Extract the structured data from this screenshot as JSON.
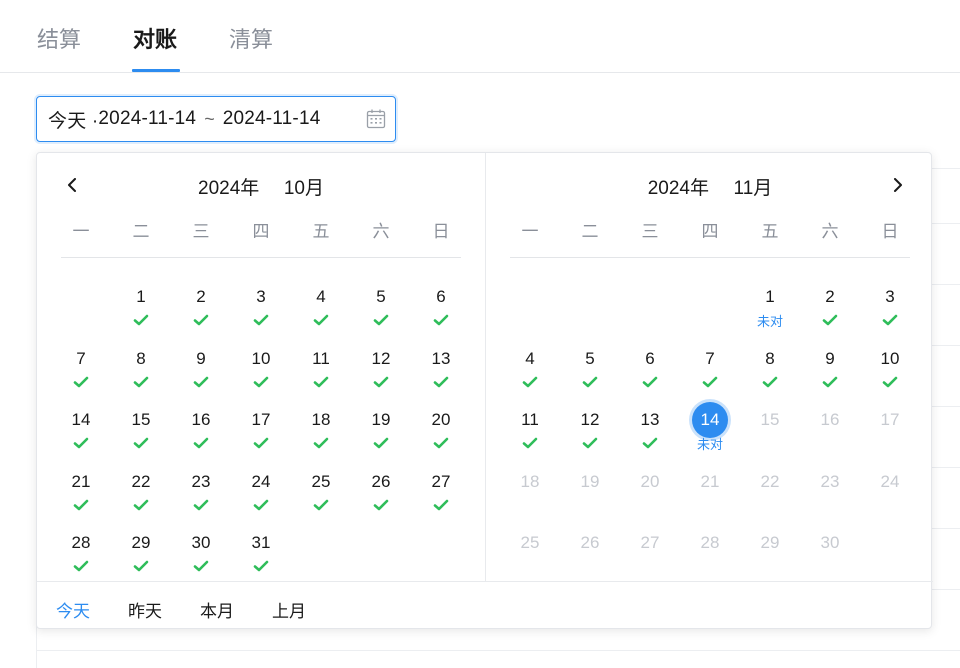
{
  "tabs": [
    {
      "label": "结算"
    },
    {
      "label": "对账"
    },
    {
      "label": "清算"
    }
  ],
  "active_tab": "对账",
  "date_range": {
    "preset": "今天 · ",
    "start": "2024-11-14",
    "separator": "~",
    "end": "2024-11-14"
  },
  "colors": {
    "accent": "#2d8cf0",
    "check": "#2fbd5a",
    "disabled_text": "#c7cad0",
    "muted_text": "#8a8f99"
  },
  "weekdays": [
    "一",
    "二",
    "三",
    "四",
    "五",
    "六",
    "日"
  ],
  "left_calendar": {
    "year": "2024年",
    "month": "10月",
    "first_weekday_index": 1,
    "days": [
      {
        "d": "1",
        "status": "check"
      },
      {
        "d": "2",
        "status": "check"
      },
      {
        "d": "3",
        "status": "check"
      },
      {
        "d": "4",
        "status": "check"
      },
      {
        "d": "5",
        "status": "check"
      },
      {
        "d": "6",
        "status": "check"
      },
      {
        "d": "7",
        "status": "check"
      },
      {
        "d": "8",
        "status": "check"
      },
      {
        "d": "9",
        "status": "check"
      },
      {
        "d": "10",
        "status": "check"
      },
      {
        "d": "11",
        "status": "check"
      },
      {
        "d": "12",
        "status": "check"
      },
      {
        "d": "13",
        "status": "check"
      },
      {
        "d": "14",
        "status": "check"
      },
      {
        "d": "15",
        "status": "check"
      },
      {
        "d": "16",
        "status": "check"
      },
      {
        "d": "17",
        "status": "check"
      },
      {
        "d": "18",
        "status": "check"
      },
      {
        "d": "19",
        "status": "check"
      },
      {
        "d": "20",
        "status": "check"
      },
      {
        "d": "21",
        "status": "check"
      },
      {
        "d": "22",
        "status": "check"
      },
      {
        "d": "23",
        "status": "check"
      },
      {
        "d": "24",
        "status": "check"
      },
      {
        "d": "25",
        "status": "check"
      },
      {
        "d": "26",
        "status": "check"
      },
      {
        "d": "27",
        "status": "check"
      },
      {
        "d": "28",
        "status": "check"
      },
      {
        "d": "29",
        "status": "check"
      },
      {
        "d": "30",
        "status": "check"
      },
      {
        "d": "31",
        "status": "check"
      }
    ]
  },
  "right_calendar": {
    "year": "2024年",
    "month": "11月",
    "first_weekday_index": 4,
    "days": [
      {
        "d": "1",
        "status": "tag",
        "tag": "未对"
      },
      {
        "d": "2",
        "status": "check"
      },
      {
        "d": "3",
        "status": "check"
      },
      {
        "d": "4",
        "status": "check"
      },
      {
        "d": "5",
        "status": "check"
      },
      {
        "d": "6",
        "status": "check"
      },
      {
        "d": "7",
        "status": "check"
      },
      {
        "d": "8",
        "status": "check"
      },
      {
        "d": "9",
        "status": "check"
      },
      {
        "d": "10",
        "status": "check"
      },
      {
        "d": "11",
        "status": "check"
      },
      {
        "d": "12",
        "status": "check"
      },
      {
        "d": "13",
        "status": "check"
      },
      {
        "d": "14",
        "status": "tag",
        "tag": "未对",
        "selected": true
      },
      {
        "d": "15",
        "disabled": true
      },
      {
        "d": "16",
        "disabled": true
      },
      {
        "d": "17",
        "disabled": true
      },
      {
        "d": "18",
        "disabled": true
      },
      {
        "d": "19",
        "disabled": true
      },
      {
        "d": "20",
        "disabled": true
      },
      {
        "d": "21",
        "disabled": true
      },
      {
        "d": "22",
        "disabled": true
      },
      {
        "d": "23",
        "disabled": true
      },
      {
        "d": "24",
        "disabled": true
      },
      {
        "d": "25",
        "disabled": true
      },
      {
        "d": "26",
        "disabled": true
      },
      {
        "d": "27",
        "disabled": true
      },
      {
        "d": "28",
        "disabled": true
      },
      {
        "d": "29",
        "disabled": true
      },
      {
        "d": "30",
        "disabled": true
      }
    ]
  },
  "shortcuts": [
    {
      "label": "今天",
      "active": true
    },
    {
      "label": "昨天"
    },
    {
      "label": "本月"
    },
    {
      "label": "上月"
    }
  ]
}
